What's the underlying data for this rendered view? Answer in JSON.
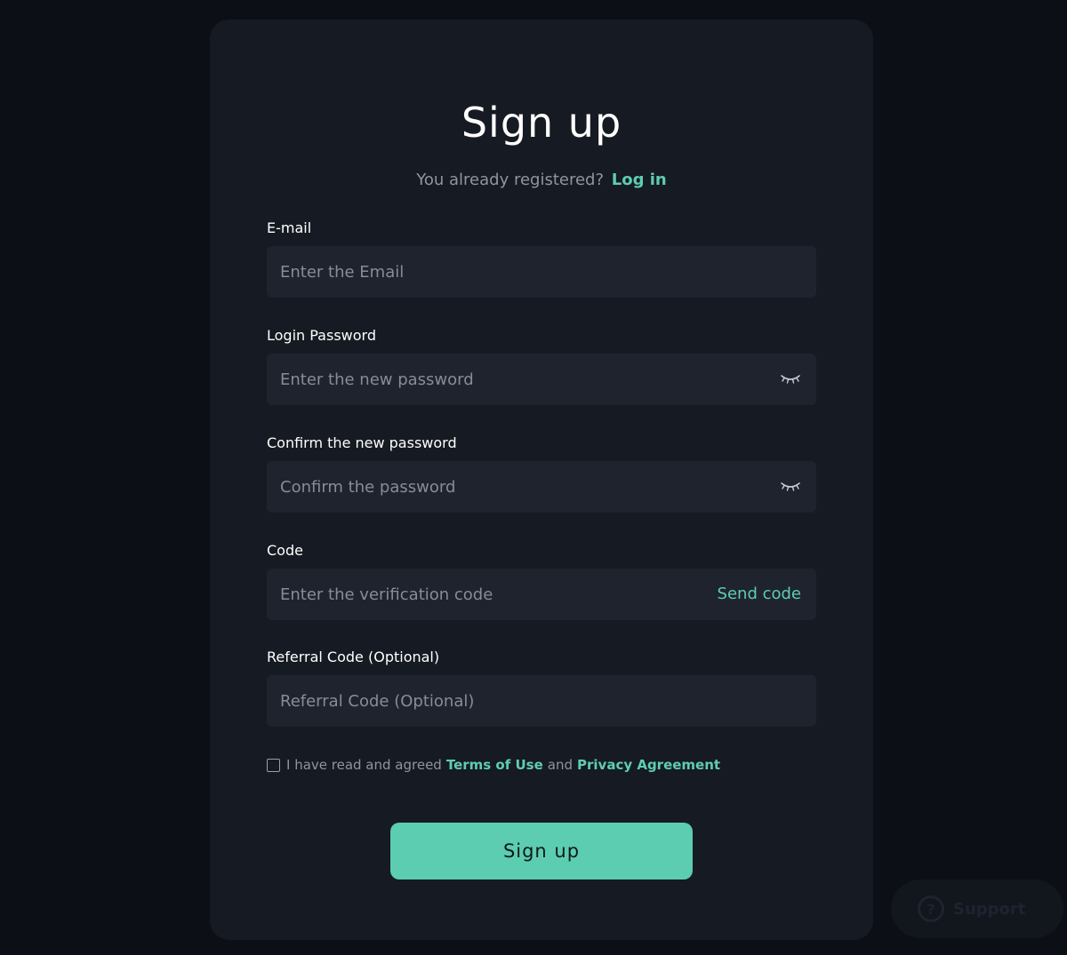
{
  "form": {
    "title": "Sign up",
    "subtitle_text": "You already registered?",
    "login_link": "Log in",
    "email": {
      "label": "E-mail",
      "placeholder": "Enter the Email"
    },
    "password": {
      "label": "Login Password",
      "placeholder": "Enter the new password"
    },
    "confirm": {
      "label": "Confirm the new password",
      "placeholder": "Confirm the password"
    },
    "code": {
      "label": "Code",
      "placeholder": "Enter the verification code",
      "send_label": "Send code"
    },
    "referral": {
      "label": "Referral Code (Optional)",
      "placeholder": "Referral Code (Optional)"
    },
    "agreement": {
      "prefix": "I have read and agreed",
      "terms": "Terms of Use",
      "conjunction": "and",
      "privacy": "Privacy Agreement",
      "checked": false
    },
    "submit_label": "Sign up"
  },
  "support": {
    "label": "Support",
    "icon": "question-icon"
  },
  "colors": {
    "accent": "#5ccdb0",
    "card": "#161a22",
    "field": "#1f232d",
    "background": "#0c0f15"
  }
}
